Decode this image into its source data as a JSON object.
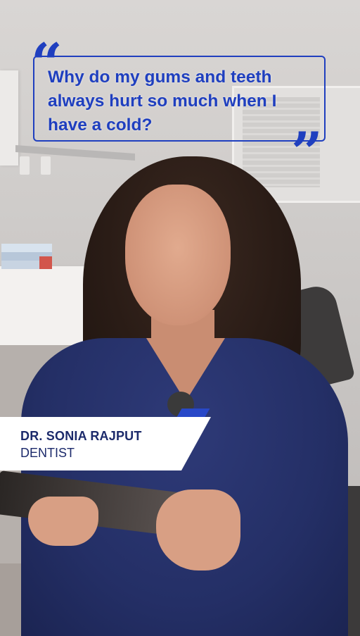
{
  "quote": {
    "text": "Why do my gums and teeth always hurt so much when I have a cold?",
    "open_mark": "“",
    "close_mark": "”"
  },
  "lower_third": {
    "name": "DR. SONIA RAJPUT",
    "title": "DENTIST"
  },
  "colors": {
    "accent": "#1f3fbf",
    "name_text": "#1c2a6b",
    "lower_third_bg": "#ffffff"
  }
}
